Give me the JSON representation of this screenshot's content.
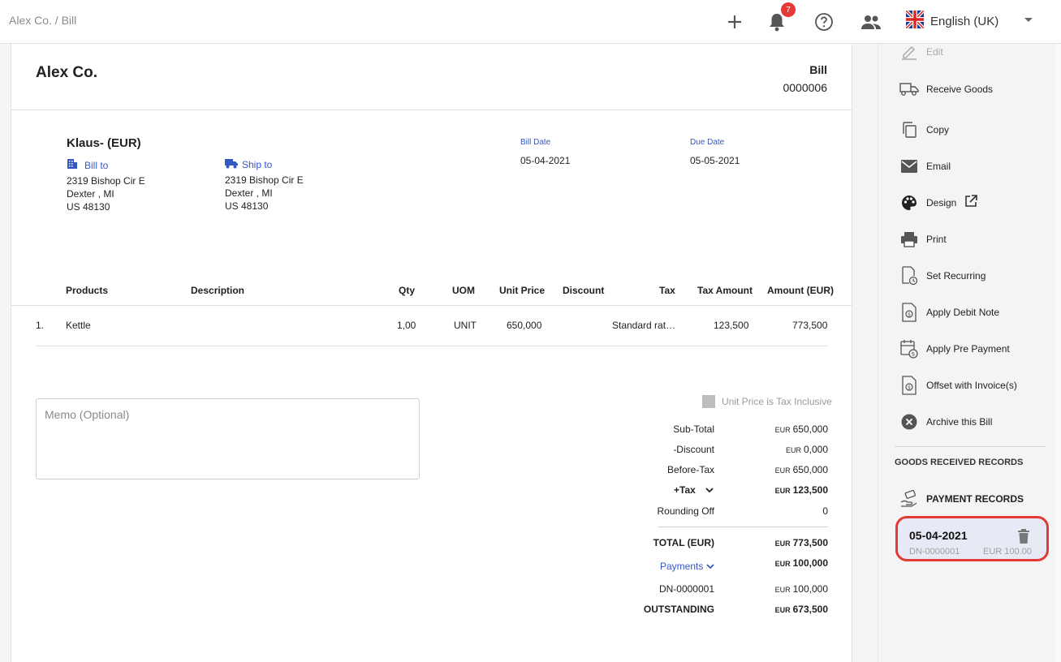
{
  "breadcrumb": "Alex Co. / Bill",
  "topbar": {
    "notification_count": "7",
    "language": "English (UK)",
    "icons": [
      "plus-icon",
      "bell-icon",
      "help-icon",
      "people-icon",
      "uk-flag-icon"
    ]
  },
  "document": {
    "company": "Alex Co.",
    "doc_type": "Bill",
    "doc_number": "0000006",
    "vendor": "Klaus- (EUR)",
    "bill_to": {
      "label": "Bill to",
      "line1": "2319 Bishop Cir E",
      "line2": "Dexter , MI",
      "line3": "US 48130"
    },
    "ship_to": {
      "label": "Ship to",
      "line1": "2319 Bishop Cir E",
      "line2": "Dexter , MI",
      "line3": "US 48130"
    },
    "bill_date_label": "Bill Date",
    "bill_date": "05-04-2021",
    "due_date_label": "Due Date",
    "due_date": "05-05-2021"
  },
  "table": {
    "headers": {
      "products": "Products",
      "description": "Description",
      "qty": "Qty",
      "uom": "UOM",
      "unit_price": "Unit Price",
      "discount": "Discount",
      "tax": "Tax",
      "tax_amount": "Tax Amount",
      "amount": "Amount (EUR)"
    },
    "rows": [
      {
        "index": "1.",
        "product": "Kettle",
        "description": "",
        "qty": "1,00",
        "uom": "UNIT",
        "unit_price": "650,000",
        "discount": "",
        "tax": "Standard rat…",
        "tax_amount": "123,500",
        "amount": "773,500"
      }
    ]
  },
  "memo_placeholder": "Memo (Optional)",
  "inclusive_label": "Unit Price is Tax Inclusive",
  "summary": {
    "currency": "EUR",
    "sub_total_label": "Sub-Total",
    "sub_total": "650,000",
    "discount_label": "-Discount",
    "discount": "0,000",
    "before_tax_label": "Before-Tax",
    "before_tax": "650,000",
    "tax_label": "+Tax",
    "tax": "123,500",
    "rounding_label": "Rounding Off",
    "rounding": "0",
    "total_label": "TOTAL (EUR)",
    "total": "773,500",
    "payments_label": "Payments",
    "payments": "100,000",
    "dn_label": "DN-0000001",
    "dn": "100,000",
    "outstanding_label": "OUTSTANDING",
    "outstanding": "673,500"
  },
  "sidebar": {
    "actions": {
      "edit": "Edit",
      "receive_goods": "Receive Goods",
      "copy": "Copy",
      "email": "Email",
      "design": "Design",
      "print": "Print",
      "set_recurring": "Set Recurring",
      "apply_debit_note": "Apply Debit Note",
      "apply_pre_payment": "Apply Pre Payment",
      "offset_invoices": "Offset with Invoice(s)",
      "archive": "Archive this Bill"
    },
    "goods_received_heading": "GOODS RECEIVED RECORDS",
    "payment_records_heading": "PAYMENT RECORDS",
    "payment_record": {
      "date": "05-04-2021",
      "ref": "DN-0000001",
      "amount": "EUR 100.00"
    }
  },
  "colors": {
    "accent": "#3557c5",
    "badge": "#e53935",
    "highlight_border": "#e53935",
    "record_bg": "#e7e9f4"
  }
}
